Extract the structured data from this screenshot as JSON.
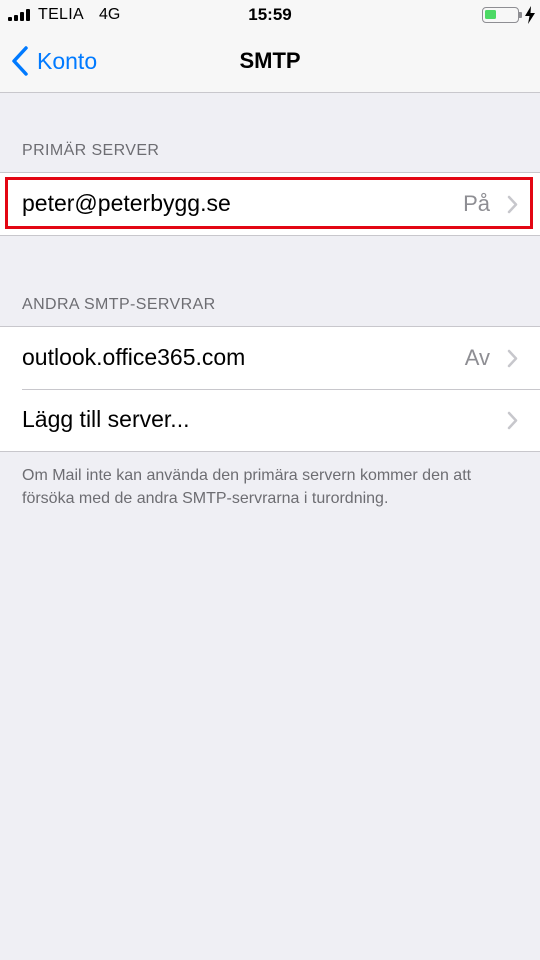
{
  "status_bar": {
    "carrier": "TELIA",
    "network": "4G",
    "time": "15:59",
    "battery_level": 0.35,
    "charging": true,
    "signal_bars": 4
  },
  "nav": {
    "back_label": "Konto",
    "title": "SMTP"
  },
  "primary": {
    "header": "PRIMÄR SERVER",
    "server": {
      "label": "peter@peterbygg.se",
      "status": "På"
    }
  },
  "other": {
    "header": "ANDRA SMTP-SERVRAR",
    "items": [
      {
        "label": "outlook.office365.com",
        "status": "Av"
      },
      {
        "label": "Lägg till server...",
        "status": ""
      }
    ],
    "footer": "Om Mail inte kan använda den primära servern kommer den att försöka med de andra SMTP-servrarna i turordning."
  },
  "colors": {
    "accent": "#007aff",
    "background": "#efeff4",
    "highlight": "#e30613",
    "battery": "#4cd964"
  },
  "icons": [
    "signal-icon",
    "battery-icon",
    "charging-bolt-icon",
    "back-chevron-icon",
    "chevron-right-icon"
  ]
}
